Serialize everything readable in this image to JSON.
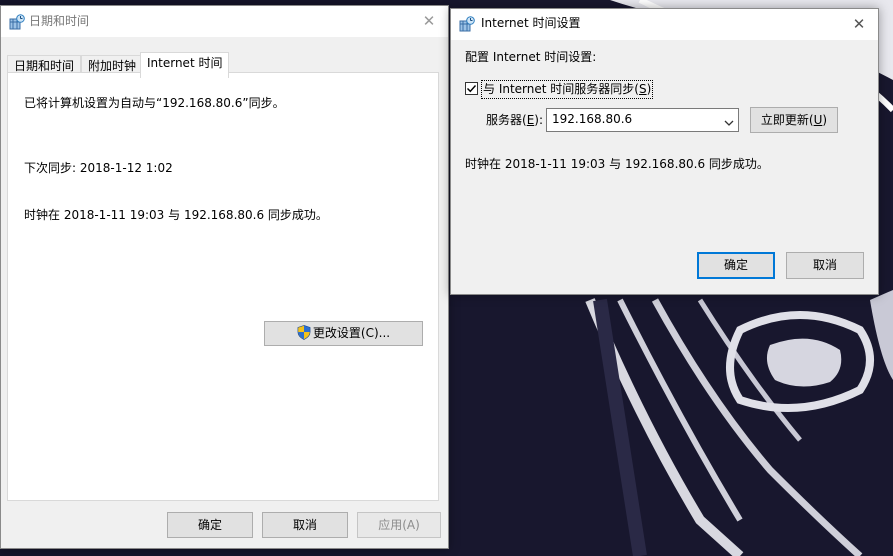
{
  "left_window": {
    "title": "日期和时间",
    "tabs": [
      "日期和时间",
      "附加时钟",
      "Internet 时间"
    ],
    "active_tab": 2,
    "sync_setting_text": "已将计算机设置为自动与“192.168.80.6”同步。",
    "next_sync_text": "下次同步: 2018-1-12 1:02",
    "last_sync_text": "时钟在 2018-1-11 19:03 与 192.168.80.6 同步成功。",
    "change_settings_button": "更改设置(C)...",
    "ok_button": "确定",
    "cancel_button": "取消",
    "apply_button": "应用(A)"
  },
  "right_window": {
    "title": "Internet 时间设置",
    "heading": "配置 Internet 时间设置:",
    "sync_checkbox_label_pre": "与 Internet 时间服务器同步(",
    "sync_checkbox_mnemonic": "S",
    "sync_checkbox_label_post": ")",
    "sync_checked": true,
    "server_label_pre": "服务器(",
    "server_label_mnemonic": "E",
    "server_label_post": "):",
    "server_value": "192.168.80.6",
    "update_now_pre": "立即更新(",
    "update_now_mnemonic": "U",
    "update_now_post": ")",
    "status_text": "时钟在 2018-1-11 19:03 与 192.168.80.6 同步成功。",
    "ok_button": "确定",
    "cancel_button": "取消"
  },
  "icons": {
    "window_icon": "date-time-globe-icon",
    "close": "close-icon",
    "shield": "uac-shield-icon",
    "dropdown": "chevron-down-icon",
    "checkbox": "checkmark-icon"
  },
  "colors": {
    "accent": "#0078d7",
    "window_bg": "#f0f0f0",
    "wallpaper_bg": "#17162d"
  }
}
